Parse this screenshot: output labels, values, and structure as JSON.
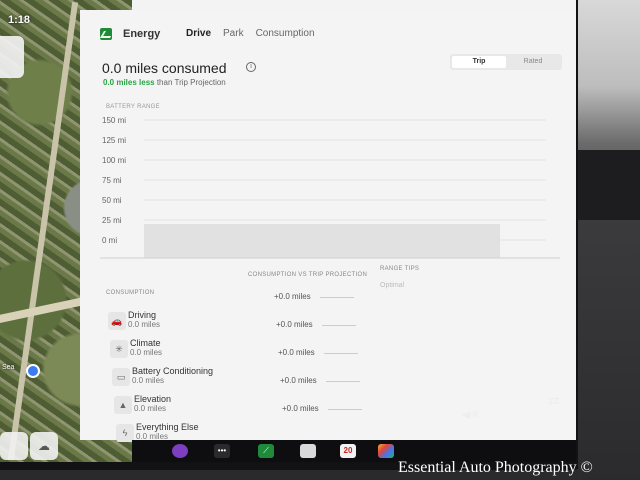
{
  "map": {
    "time": "1:18",
    "town": "Sea"
  },
  "header": {
    "title": "Energy",
    "tabs": [
      "Drive",
      "Park",
      "Consumption"
    ]
  },
  "summary": {
    "headline": "0.0 miles consumed",
    "sub_highlight": "0.0 miles less",
    "sub_rest": "than Trip Projection"
  },
  "toggle": {
    "options": [
      "Trip",
      "Rated"
    ],
    "selected": "Trip"
  },
  "chart_data": {
    "type": "area",
    "ylabel": "BATTERY RANGE",
    "y_ticks": [
      "150 mi",
      "125 mi",
      "100 mi",
      "75 mi",
      "50 mi",
      "25 mi",
      "0 mi"
    ],
    "ylim": [
      0,
      150
    ],
    "series": [
      {
        "values": [
          20,
          20
        ]
      }
    ],
    "grid": true
  },
  "consumption": {
    "label": "CONSUMPTION",
    "compare_label": "CONSUMPTION VS TRIP PROJECTION",
    "tips_label": "RANGE TIPS",
    "tips_value": "Optimal",
    "items": [
      {
        "name": "Driving",
        "value": "0.0 miles",
        "compare": "+0.0 miles",
        "icon": "car-icon"
      },
      {
        "name": "Climate",
        "value": "0.0 miles",
        "compare": "+0.0 miles",
        "icon": "fan-icon"
      },
      {
        "name": "Battery Conditioning",
        "value": "0.0 miles",
        "compare": "+0.0 miles",
        "icon": "battery-icon"
      },
      {
        "name": "Elevation",
        "value": "0.0 miles",
        "compare": "+0.0 miles",
        "icon": "mountain-icon"
      },
      {
        "name": "Everything Else",
        "value": "0.0 miles",
        "compare": "+0.0 miles",
        "icon": "bolt-icon"
      }
    ]
  },
  "taskbar": {
    "calendar_day": "20"
  },
  "colors": {
    "accent_green": "#26a543",
    "energy_icon": "#1f8a3a"
  },
  "watermark": "Essential Auto Photography ©"
}
